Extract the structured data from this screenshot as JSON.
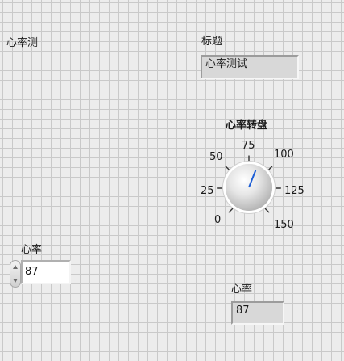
{
  "front_panel": {
    "vi_label": "心率测"
  },
  "title_indicator": {
    "label": "标题",
    "value": "心率测试"
  },
  "dial": {
    "label": "心率转盘",
    "scale_min": 0,
    "scale_max": 150,
    "value": 87,
    "ticks": [
      "0",
      "25",
      "50",
      "75",
      "100",
      "125",
      "150"
    ],
    "needle_color": "#1e5fd6"
  },
  "heart_rate_control": {
    "label": "心率",
    "value": "87"
  },
  "heart_rate_indicator": {
    "label": "心率",
    "value": "87"
  }
}
